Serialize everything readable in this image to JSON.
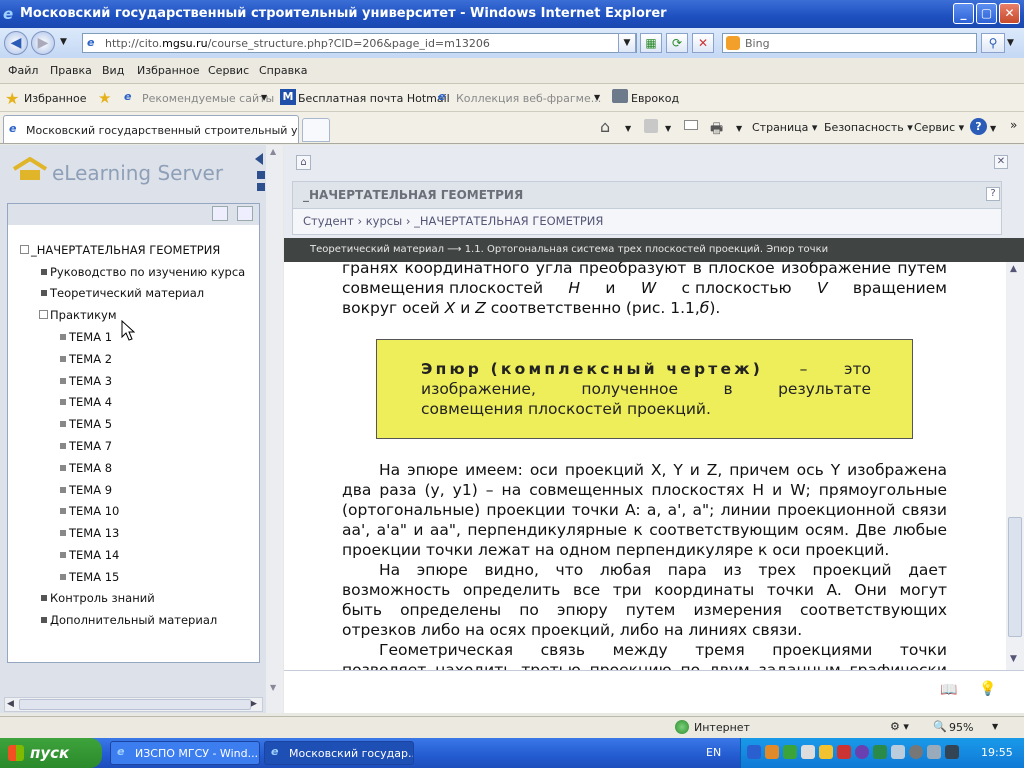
{
  "window": {
    "title": "Московский государственный строительный университет - Windows Internet Explorer"
  },
  "address": {
    "url_prefix": "http://cito.",
    "url_domain": "mgsu.ru",
    "url_rest": "/course_structure.php?CID=206&page_id=m13206",
    "search_placeholder": "Bing"
  },
  "menu": [
    "Файл",
    "Правка",
    "Вид",
    "Избранное",
    "Сервис",
    "Справка"
  ],
  "favorites": {
    "label": "Избранное",
    "items": [
      "Рекомендуемые сайты",
      "Бесплатная почта Hotmail",
      "Коллекция веб-фрагме...",
      "Еврокод"
    ]
  },
  "tab": {
    "title": "Московский государственный строительный унив..."
  },
  "commands": [
    "Страница",
    "Безопасность",
    "Сервис"
  ],
  "sidebar": {
    "logo": "eLearning Server",
    "tree": {
      "root": "_НАЧЕРТАТЕЛЬНАЯ ГЕОМЕТРИЯ",
      "items": [
        "Руководство по изучению курса",
        "Теоретический материал",
        "Практикум"
      ],
      "topics": [
        "ТЕМА 1",
        "ТЕМА 2",
        "ТЕМА 3",
        "ТЕМА 4",
        "ТЕМА 5",
        "ТЕМА 7",
        "ТЕМА 8",
        "ТЕМА 9",
        "ТЕМА 10",
        "ТЕМА 13",
        "ТЕМА 14",
        "ТЕМА 15"
      ],
      "after": [
        "Контроль знаний",
        "Дополнительный материал"
      ]
    }
  },
  "main": {
    "course_title": "_НАЧЕРТАТЕЛЬНАЯ ГЕОМЕТРИЯ",
    "breadcrumb": {
      "student": "Студент",
      "courses": "курсы",
      "course": "_НАЧЕРТАТЕЛЬНАЯ ГЕОМЕТРИЯ",
      "sep": "›"
    },
    "path": "Теоретический материал ⟶ 1.1. Ортогональная система трех плоскостей проекций. Эпюр точки",
    "para1_line1": "гранях координатного угла преобразуют в плоское изображение путем",
    "para1_line2_a": "совмещения плоскостей",
    "para1_line2_h": "H",
    "para1_line2_and": "и",
    "para1_line2_w": "W",
    "para1_line2_b": "с плоскостью",
    "para1_line2_v": "V",
    "para1_line2_c": "вращением",
    "para1_line3_a": "вокруг осей",
    "para1_line3_x": "X",
    "para1_line3_and": "и",
    "para1_line3_z": "Z",
    "para1_line3_b": "соответственно (рис. 1.1,",
    "para1_line3_fig": "б",
    "para1_line3_c": ").",
    "def_term": "Эпюр (комплексный чертеж)",
    "def_dash": "–",
    "def_rest1": "это",
    "def_line2": "изображение, полученное в результате",
    "def_line3": "совмещения плоскостей проекций.",
    "p2_l1": "На эпюре имеем: оси проекций X, Y и Z, причем ось Y изображена",
    "p2_l2": "два раза (y, y1) – на совмещенных плоскостях H и W; прямоугольные",
    "p2_l3": "(ортогональные) проекции точки A: a, a', a\"; линии проекционной связи",
    "p2_l4": "aa', a'a\" и aa\", перпендикулярные к соответствующим осям. Две любые",
    "p2_l5": "проекции точки лежат на одном перпендикуляре к оси проекций.",
    "p3_l1": "На эпюре видно, что любая пара из трех проекций дает",
    "p3_l2": "возможность определить все три координаты точки A. Они могут",
    "p3_l3": "быть определены по эпюру путем измерения соответствующих",
    "p3_l4": "отрезков либо на осях проекций, либо на линиях связи.",
    "p4_l1": "Геометрическая связь между тремя проекциями точки",
    "p4_l2": "позволяет находить третью проекцию по двум заданным графически"
  },
  "statusbar": {
    "zone": "Интернет",
    "zoom": "95%"
  },
  "taskbar": {
    "start": "пуск",
    "items": [
      "ИЗСПО МГСУ - Wind...",
      "Московский государ..."
    ],
    "lang": "EN",
    "clock": "19:55"
  },
  "colors": {
    "accent": "#1d4fbf",
    "defbox": "#eeee5a",
    "pathbar": "#404442"
  }
}
